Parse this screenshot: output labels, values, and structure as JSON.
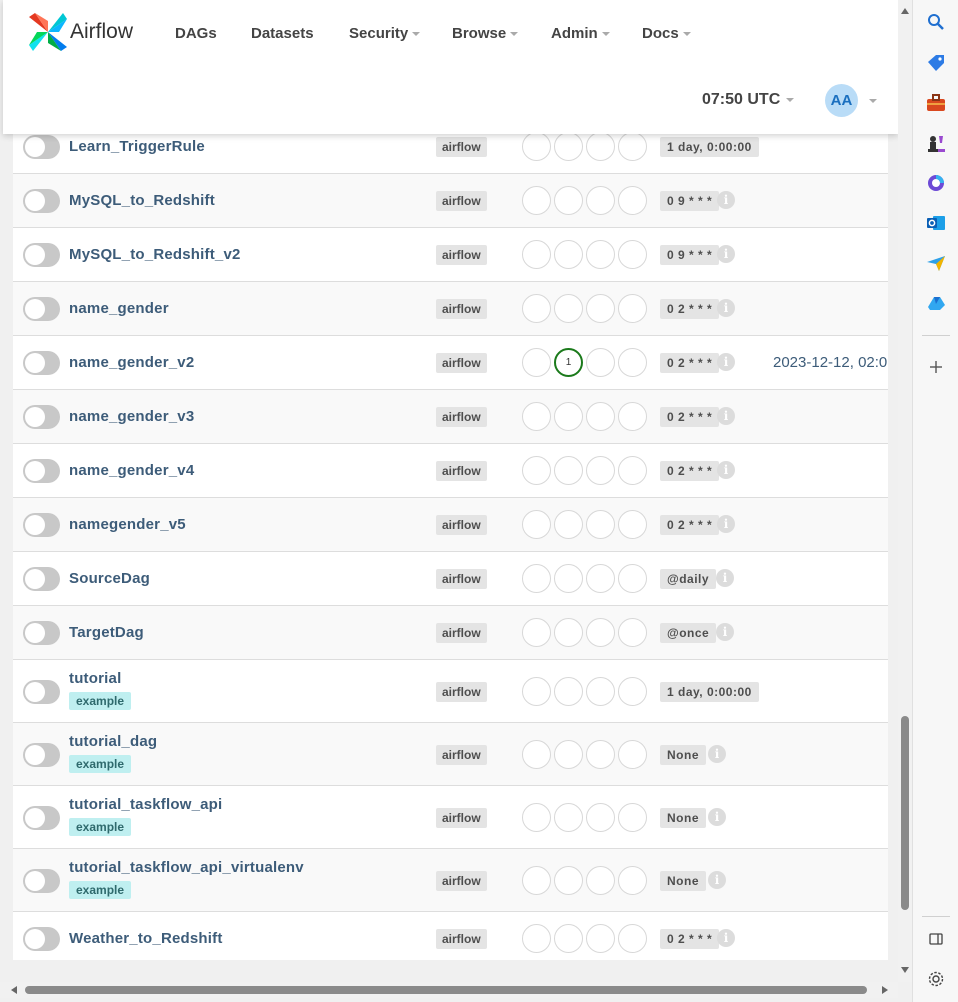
{
  "header": {
    "brand": "Airflow",
    "nav": [
      {
        "label": "DAGs",
        "dropdown": false
      },
      {
        "label": "Datasets",
        "dropdown": false
      },
      {
        "label": "Security",
        "dropdown": true
      },
      {
        "label": "Browse",
        "dropdown": true
      },
      {
        "label": "Admin",
        "dropdown": true
      },
      {
        "label": "Docs",
        "dropdown": true
      }
    ],
    "clock": "07:50 UTC",
    "user_initials": "AA"
  },
  "dags": [
    {
      "name": "Learn_TriggerRule",
      "tag": "",
      "owner": "airflow",
      "schedule": "1 day, 0:00:00",
      "info": false,
      "run_count": "",
      "last_run": ""
    },
    {
      "name": "MySQL_to_Redshift",
      "tag": "",
      "owner": "airflow",
      "schedule": "0 9 * * *",
      "info": true,
      "run_count": "",
      "last_run": ""
    },
    {
      "name": "MySQL_to_Redshift_v2",
      "tag": "",
      "owner": "airflow",
      "schedule": "0 9 * * *",
      "info": true,
      "run_count": "",
      "last_run": ""
    },
    {
      "name": "name_gender",
      "tag": "",
      "owner": "airflow",
      "schedule": "0 2 * * *",
      "info": true,
      "run_count": "",
      "last_run": ""
    },
    {
      "name": "name_gender_v2",
      "tag": "",
      "owner": "airflow",
      "schedule": "0 2 * * *",
      "info": true,
      "run_count": "1",
      "last_run": "2023-12-12, 02:0"
    },
    {
      "name": "name_gender_v3",
      "tag": "",
      "owner": "airflow",
      "schedule": "0 2 * * *",
      "info": true,
      "run_count": "",
      "last_run": ""
    },
    {
      "name": "name_gender_v4",
      "tag": "",
      "owner": "airflow",
      "schedule": "0 2 * * *",
      "info": true,
      "run_count": "",
      "last_run": ""
    },
    {
      "name": "namegender_v5",
      "tag": "",
      "owner": "airflow",
      "schedule": "0 2 * * *",
      "info": true,
      "run_count": "",
      "last_run": ""
    },
    {
      "name": "SourceDag",
      "tag": "",
      "owner": "airflow",
      "schedule": "@daily",
      "info": true,
      "run_count": "",
      "last_run": ""
    },
    {
      "name": "TargetDag",
      "tag": "",
      "owner": "airflow",
      "schedule": "@once",
      "info": true,
      "run_count": "",
      "last_run": ""
    },
    {
      "name": "tutorial",
      "tag": "example",
      "owner": "airflow",
      "schedule": "1 day, 0:00:00",
      "info": false,
      "run_count": "",
      "last_run": ""
    },
    {
      "name": "tutorial_dag",
      "tag": "example",
      "owner": "airflow",
      "schedule": "None",
      "info": true,
      "run_count": "",
      "last_run": ""
    },
    {
      "name": "tutorial_taskflow_api",
      "tag": "example",
      "owner": "airflow",
      "schedule": "None",
      "info": true,
      "run_count": "",
      "last_run": ""
    },
    {
      "name": "tutorial_taskflow_api_virtualenv",
      "tag": "example",
      "owner": "airflow",
      "schedule": "None",
      "info": true,
      "run_count": "",
      "last_run": ""
    },
    {
      "name": "Weather_to_Redshift",
      "tag": "",
      "owner": "airflow",
      "schedule": "0 2 * * *",
      "info": true,
      "run_count": "",
      "last_run": ""
    }
  ],
  "info_glyph": "i",
  "colors": {
    "dag_link": "#3d5c79",
    "tag_example_bg": "#bfeff0",
    "running_ring": "#1b7a1b",
    "avatar_bg": "#b9dcf7"
  },
  "sidebar_icons": [
    "search-icon",
    "tag-icon",
    "toolbox-icon",
    "chess-icon",
    "office-icon",
    "outlook-icon",
    "send-icon",
    "drive-icon",
    "add-icon",
    "split-view-icon",
    "settings-icon"
  ]
}
